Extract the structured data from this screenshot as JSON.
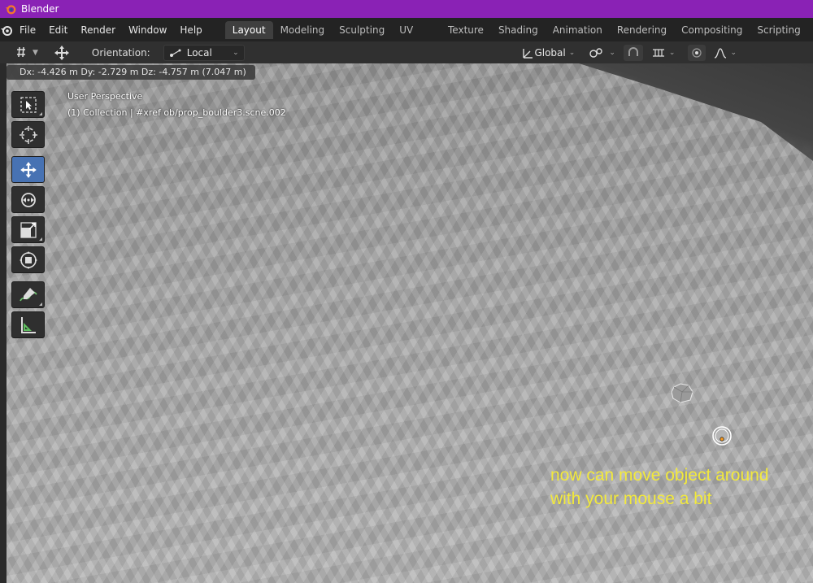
{
  "window": {
    "title": "Blender"
  },
  "menu": {
    "items": [
      "File",
      "Edit",
      "Render",
      "Window",
      "Help"
    ]
  },
  "workspaces": {
    "tabs": [
      "Layout",
      "Modeling",
      "Sculpting",
      "UV Editing",
      "Texture Paint",
      "Shading",
      "Animation",
      "Rendering",
      "Compositing",
      "Scripting"
    ],
    "active": "Layout",
    "add_label": "+"
  },
  "header": {
    "orientation_label": "Orientation:",
    "orientation_value": "Local",
    "pivot_value": "Global"
  },
  "viewport": {
    "transform_readout": "Dx: -4.426 m  Dy: -2.729 m  Dz: -4.757 m (7.047 m)",
    "perspective": "User Perspective",
    "collection": "(1) Collection | #xref ob/prop_boulder3.scne.002"
  },
  "annotation": {
    "line1": "now can move object around",
    "line2": "with your mouse a bit",
    "color": "#f2e93c"
  },
  "colors": {
    "titlebar": "#8a22b5",
    "active_tool": "#4772b3"
  },
  "icons": [
    "blender-logo-icon",
    "select-box-icon",
    "cursor-icon",
    "move-icon",
    "rotate-icon",
    "scale-icon",
    "transform-icon",
    "annotate-icon",
    "measure-icon",
    "transform-orientation-icon",
    "pivot-icon",
    "snap-icon",
    "proportional-edit-icon"
  ]
}
